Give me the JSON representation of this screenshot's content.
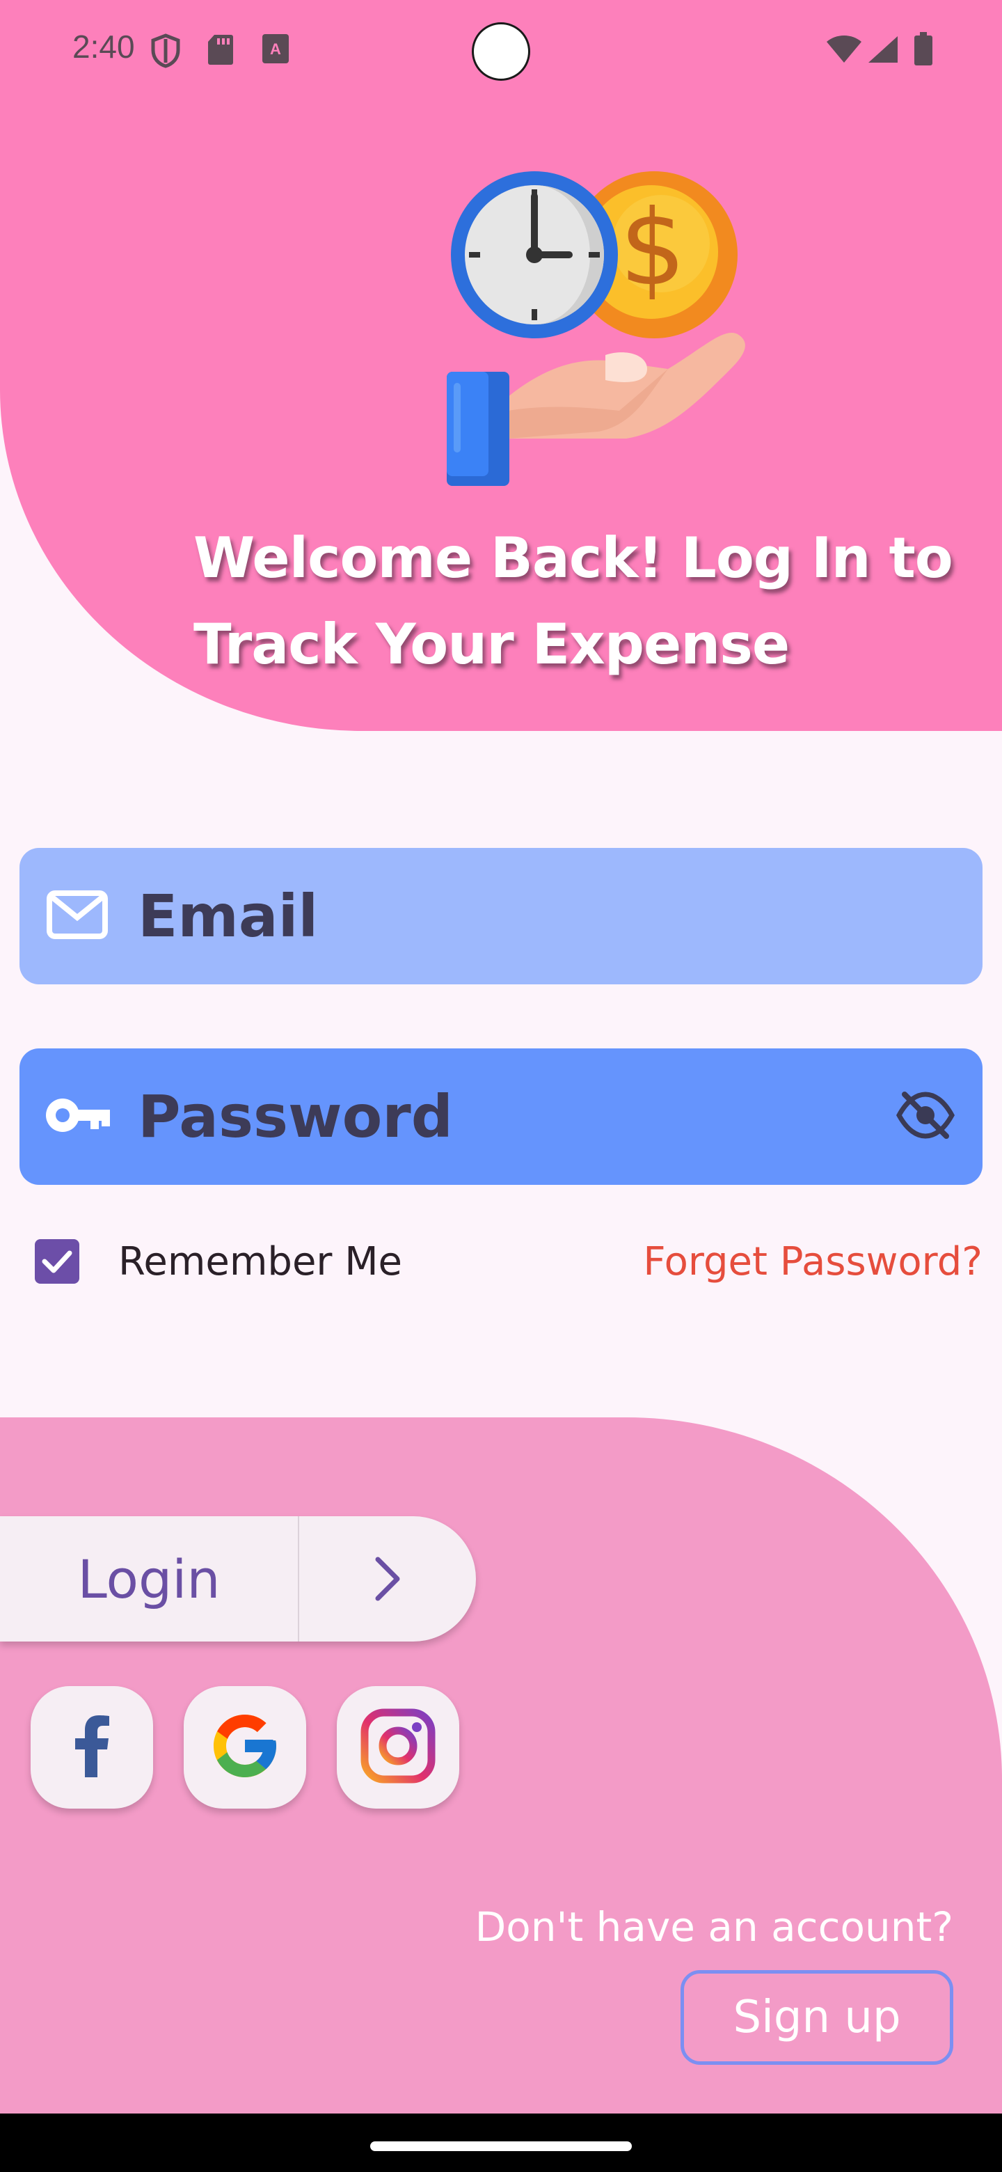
{
  "status_bar": {
    "time": "2:40"
  },
  "hero": {
    "title": "Welcome Back! Log In to Track Your Expense"
  },
  "form": {
    "email_placeholder": "Email",
    "password_placeholder": "Password",
    "remember_me_label": "Remember Me",
    "remember_me_checked": true,
    "forgot_password_label": "Forget Password?"
  },
  "actions": {
    "login_label": "Login",
    "no_account_text": "Don't have an account?",
    "signup_label": "Sign up"
  },
  "social": [
    {
      "name": "facebook-icon"
    },
    {
      "name": "google-icon"
    },
    {
      "name": "instagram-icon"
    }
  ],
  "colors": {
    "top_blob": "#fd80bb",
    "bottom_blob": "#f39bc7",
    "email_field": "#9db8fd",
    "password_field": "#6594fd",
    "accent_purple": "#6c4ea8",
    "forgot_red": "#e64d3d"
  }
}
